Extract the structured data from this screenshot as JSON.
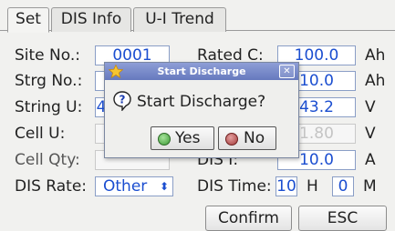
{
  "tabs": [
    {
      "label": "Set"
    },
    {
      "label": "DIS Info"
    },
    {
      "label": "U-I Trend"
    }
  ],
  "fields": {
    "site_no": {
      "label": "Site No.:",
      "value": "0001"
    },
    "strg_no": {
      "label": "Strg No.:",
      "value": ""
    },
    "string_u": {
      "label": "String U:",
      "value": "4"
    },
    "cell_u": {
      "label": "Cell U:",
      "value": ""
    },
    "cell_qty": {
      "label": "Cell Qty:",
      "value": ""
    },
    "dis_rate": {
      "label": "DIS Rate:",
      "value": "Other",
      "arrow": "⬍"
    },
    "rated_c": {
      "label": "Rated C:",
      "value": "100.0",
      "unit": "Ah"
    },
    "field2": {
      "value": "10.0",
      "unit": "Ah"
    },
    "field3": {
      "value": "43.2",
      "unit": "V"
    },
    "field4": {
      "value": "1.80",
      "unit": "V"
    },
    "dis_i": {
      "label": "DIS I:",
      "value": "10.0",
      "unit": "A"
    },
    "dis_time": {
      "label": "DIS Time:",
      "hours": "10",
      "h_unit": "H",
      "minutes": "0",
      "m_unit": "M"
    }
  },
  "buttons": {
    "confirm": "Confirm",
    "esc": "ESC"
  },
  "dialog": {
    "title": "Start Discharge",
    "close": "✕",
    "message": "Start Discharge?",
    "yes": "Yes",
    "no": "No"
  },
  "colors": {
    "accent": "#1b4ed0",
    "title_bar": "#7a8bc9",
    "yes_icon": "#3c9a35",
    "no_icon": "#a33a3a"
  }
}
